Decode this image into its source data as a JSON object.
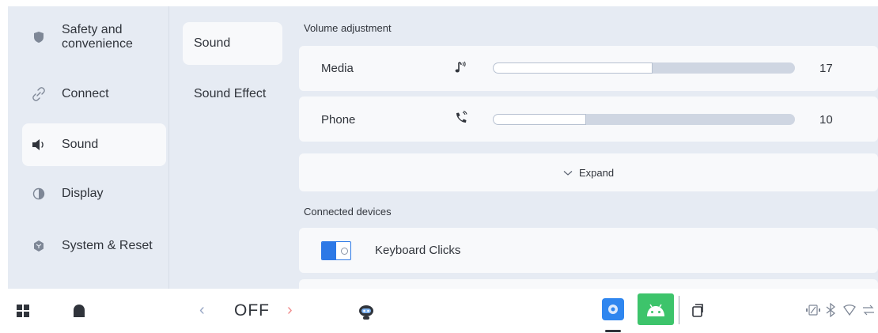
{
  "nav": {
    "items": [
      {
        "label": "Safety and convenience",
        "icon": "shield-icon"
      },
      {
        "label": "Connect",
        "icon": "link-icon"
      },
      {
        "label": "Sound",
        "icon": "speaker-icon",
        "active": true
      },
      {
        "label": "Display",
        "icon": "display-icon"
      },
      {
        "label": "System & Reset",
        "icon": "hexagon-icon"
      }
    ]
  },
  "subnav": {
    "items": [
      {
        "label": "Sound",
        "active": true
      },
      {
        "label": "Sound Effect"
      }
    ]
  },
  "volume": {
    "section_label": "Volume adjustment",
    "rows": [
      {
        "label": "Media",
        "icon": "media-note-icon",
        "value": "17",
        "level": 0.53
      },
      {
        "label": "Phone",
        "icon": "phone-ring-icon",
        "value": "10",
        "level": 0.31
      }
    ],
    "expand_label": "Expand"
  },
  "connected": {
    "section_label": "Connected devices",
    "keyboard_clicks": {
      "label": "Keyboard Clicks",
      "on": true
    }
  },
  "taskbar": {
    "mode_label": "OFF"
  },
  "colors": {
    "accent": "#2d79e6",
    "background": "#e6ebf3",
    "card": "#f8f9fb",
    "app_green": "#3dc46b",
    "app_blue": "#2f86ef"
  }
}
